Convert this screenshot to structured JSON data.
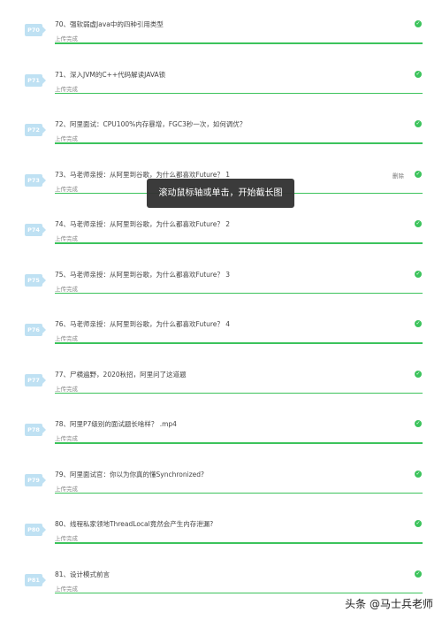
{
  "colors": {
    "badge": "#bfe1f3",
    "progress": "#3cc35c",
    "tooltip_bg": "#333333"
  },
  "items": [
    {
      "badge": "P70",
      "title": "70、强软弱虚Java中的四种引用类型",
      "status": "上传完成",
      "progress": 1.0
    },
    {
      "badge": "P71",
      "title": "71、深入JVM的C++代码解读JAVA锁",
      "status": "上传完成",
      "progress": 1.0
    },
    {
      "badge": "P72",
      "title": "72、阿里面试：CPU100%内存暴增，FGC3秒一次，如何调优？",
      "status": "上传完成",
      "progress": 1.0
    },
    {
      "badge": "P73",
      "title": "73、马老师亲授：从阿里到谷歌，为什么都喜欢Future？ 1",
      "status": "上传完成",
      "progress": 1.0,
      "delete": "删除"
    },
    {
      "badge": "P74",
      "title": "74、马老师亲授：从阿里到谷歌，为什么都喜欢Future？ 2",
      "status": "上传完成",
      "progress": 1.0
    },
    {
      "badge": "P75",
      "title": "75、马老师亲授：从阿里到谷歌，为什么都喜欢Future？ 3",
      "status": "上传完成",
      "progress": 1.0
    },
    {
      "badge": "P76",
      "title": "76、马老师亲授：从阿里到谷歌，为什么都喜欢Future？ 4",
      "status": "上传完成",
      "progress": 1.0
    },
    {
      "badge": "P77",
      "title": "77、尸横遍野，2020秋招，阿里问了这道题",
      "status": "上传完成",
      "progress": 1.0
    },
    {
      "badge": "P78",
      "title": "78、阿里P7级别的面试题长啥样？ .mp4",
      "status": "上传完成",
      "progress": 1.0
    },
    {
      "badge": "P79",
      "title": "79、阿里面试官：你以为你真的懂Synchronized?",
      "status": "上传完成",
      "progress": 1.0
    },
    {
      "badge": "P80",
      "title": "80、线程私家领地ThreadLocal竟然会产生内存泄漏?",
      "status": "上传完成",
      "progress": 1.0
    },
    {
      "badge": "P81",
      "title": "81、设计模式前言",
      "status": "上传完成",
      "progress": 1.0
    }
  ],
  "tooltip": "滚动鼠标轴或单击，开始截长图",
  "watermark": "头条 @马士兵老师"
}
